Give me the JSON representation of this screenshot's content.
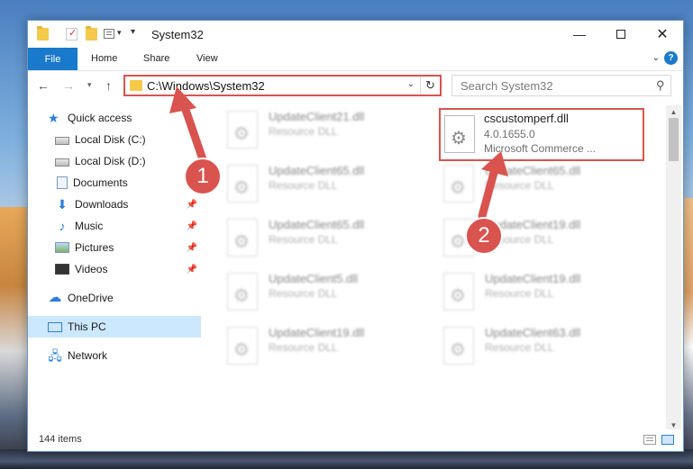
{
  "window": {
    "title": "System32",
    "minimize_glyph": "—",
    "close_glyph": "✕"
  },
  "ribbon": {
    "file_tab": "File",
    "tabs": [
      "Home",
      "Share",
      "View"
    ],
    "help_glyph": "?"
  },
  "navigation": {
    "back_glyph": "←",
    "forward_glyph": "→",
    "up_glyph": "↑",
    "address": "C:\\Windows\\System32",
    "search_placeholder": "Search System32"
  },
  "sidebar": {
    "items": [
      {
        "label": "Quick access",
        "icon": "star-icon"
      },
      {
        "label": "Local Disk (C:)",
        "icon": "drive-icon"
      },
      {
        "label": "Local Disk (D:)",
        "icon": "drive-icon"
      },
      {
        "label": "Documents",
        "icon": "document-icon"
      },
      {
        "label": "Downloads",
        "icon": "download-icon",
        "pinned": true
      },
      {
        "label": "Music",
        "icon": "music-icon",
        "pinned": true
      },
      {
        "label": "Pictures",
        "icon": "pictures-icon",
        "pinned": true
      },
      {
        "label": "Videos",
        "icon": "videos-icon",
        "pinned": true
      },
      {
        "label": "OneDrive",
        "icon": "onedrive-icon"
      },
      {
        "label": "This PC",
        "icon": "pc-icon",
        "selected": true
      },
      {
        "label": "Network",
        "icon": "network-icon"
      }
    ]
  },
  "files": {
    "left_column": [
      {
        "name": "UpdateClient21.dll",
        "type": "Resource DLL"
      },
      {
        "name": "UpdateClient65.dll",
        "type": "Resource DLL"
      },
      {
        "name": "UpdateClient65.dll",
        "type": "Resource DLL"
      },
      {
        "name": "UpdateClient5.dll",
        "type": "Resource DLL"
      },
      {
        "name": "UpdateClient19.dll",
        "type": "Resource DLL"
      }
    ],
    "right_column": [
      {
        "name": "UpdateClient65.dll",
        "type": "Resource DLL"
      },
      {
        "name": "UpdateClient19.dll",
        "type": "Resource DLL"
      },
      {
        "name": "UpdateClient19.dll",
        "type": "Resource DLL"
      },
      {
        "name": "UpdateClient63.dll",
        "type": "Resource DLL"
      }
    ],
    "highlighted": {
      "name": "cscustomperf.dll",
      "version": "4.0.1655.0",
      "company": "Microsoft Commerce ..."
    }
  },
  "status": {
    "item_count": "144 items"
  },
  "annotations": {
    "step1": "1",
    "step2": "2",
    "color": "#d9534f"
  }
}
